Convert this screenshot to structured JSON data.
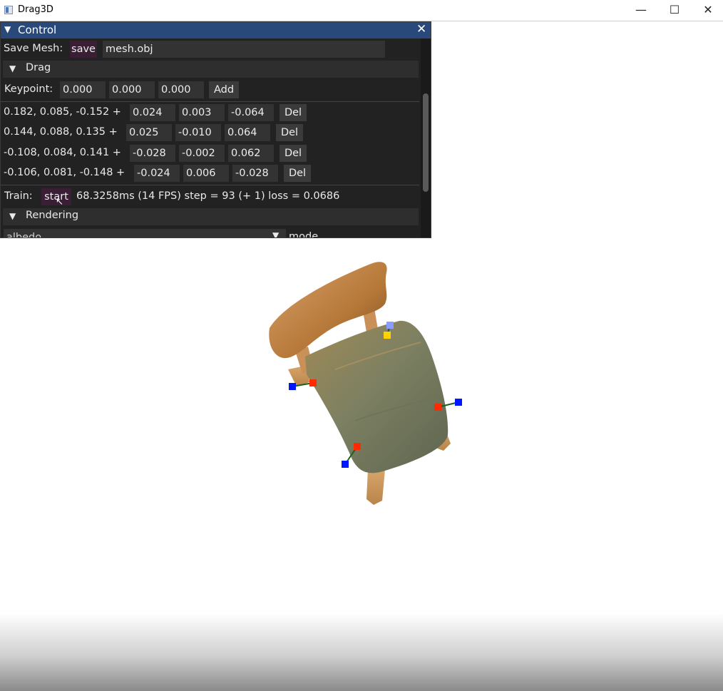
{
  "window": {
    "title": "Drag3D",
    "icon": "app-window-icon",
    "controls": {
      "minimize": "—",
      "maximize": "☐",
      "close": "✕"
    }
  },
  "panel": {
    "title": "Control",
    "close_glyph": "✕",
    "save": {
      "label": "Save Mesh:",
      "button": "save",
      "filename": "mesh.obj"
    },
    "drag_section": "Drag",
    "keypoint": {
      "label": "Keypoint:",
      "x": "0.000",
      "y": "0.000",
      "z": "0.000",
      "add_button": "Add"
    },
    "points": [
      {
        "base": "0.182, 0.085, -0.152 +",
        "dx": "0.024",
        "dy": "0.003",
        "dz": "-0.064",
        "del": "Del"
      },
      {
        "base": "0.144, 0.088, 0.135 +",
        "dx": "0.025",
        "dy": "-0.010",
        "dz": "0.064",
        "del": "Del"
      },
      {
        "base": "-0.108, 0.084, 0.141 +",
        "dx": "-0.028",
        "dy": "-0.002",
        "dz": "0.062",
        "del": "Del"
      },
      {
        "base": "-0.106, 0.081, -0.148 +",
        "dx": "-0.024",
        "dy": "0.006",
        "dz": "-0.028",
        "del": "Del"
      }
    ],
    "train": {
      "label": "Train:",
      "button": "start",
      "status": "68.3258ms (14 FPS)  step =   93 (+ 1)  loss = 0.0686"
    },
    "rendering_section": "Rendering",
    "rendering": {
      "mode_value": "albedo",
      "mode_label": "mode"
    }
  },
  "colors": {
    "header": "#29497a",
    "panel_bg": "#222222",
    "field_bg": "#333333",
    "handle_source": "#ff2a00",
    "handle_target": "#0016ff",
    "handle_yellow": "#ffd200",
    "handle_light_blue": "#8a9cff"
  }
}
